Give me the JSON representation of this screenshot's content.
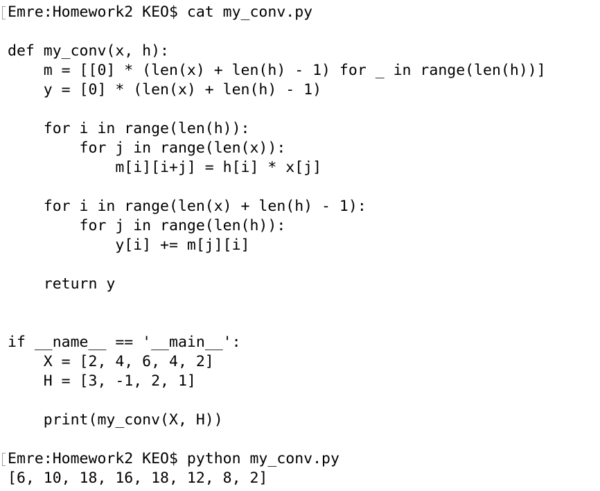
{
  "terminal": {
    "lines": [
      {
        "text": "Emre:Homework2 KEO$ cat my_conv.py",
        "prompt": true
      },
      {
        "text": "",
        "prompt": false
      },
      {
        "text": "def my_conv(x, h):",
        "prompt": false
      },
      {
        "text": "    m = [[0] * (len(x) + len(h) - 1) for _ in range(len(h))]",
        "prompt": false
      },
      {
        "text": "    y = [0] * (len(x) + len(h) - 1)",
        "prompt": false
      },
      {
        "text": "",
        "prompt": false
      },
      {
        "text": "    for i in range(len(h)):",
        "prompt": false
      },
      {
        "text": "        for j in range(len(x)):",
        "prompt": false
      },
      {
        "text": "            m[i][i+j] = h[i] * x[j]",
        "prompt": false
      },
      {
        "text": "",
        "prompt": false
      },
      {
        "text": "    for i in range(len(x) + len(h) - 1):",
        "prompt": false
      },
      {
        "text": "        for j in range(len(h)):",
        "prompt": false
      },
      {
        "text": "            y[i] += m[j][i]",
        "prompt": false
      },
      {
        "text": "",
        "prompt": false
      },
      {
        "text": "    return y",
        "prompt": false
      },
      {
        "text": "",
        "prompt": false
      },
      {
        "text": "",
        "prompt": false
      },
      {
        "text": "if __name__ == '__main__':",
        "prompt": false
      },
      {
        "text": "    X = [2, 4, 6, 4, 2]",
        "prompt": false
      },
      {
        "text": "    H = [3, -1, 2, 1]",
        "prompt": false
      },
      {
        "text": "",
        "prompt": false
      },
      {
        "text": "    print(my_conv(X, H))",
        "prompt": false
      },
      {
        "text": "",
        "prompt": false
      },
      {
        "text": "Emre:Homework2 KEO$ python my_conv.py",
        "prompt": true
      },
      {
        "text": "[6, 10, 18, 16, 18, 12, 8, 2]",
        "prompt": false
      }
    ]
  }
}
